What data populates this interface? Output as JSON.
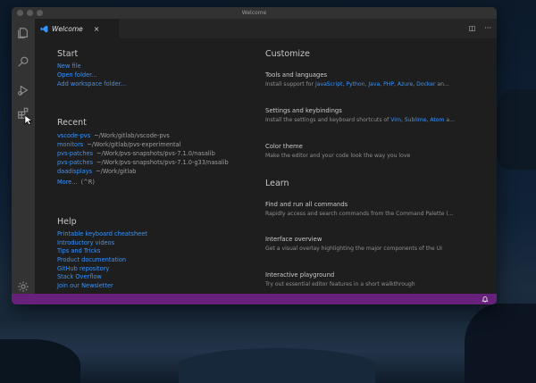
{
  "window": {
    "title": "Welcome"
  },
  "tab": {
    "label": "Welcome",
    "close": "×"
  },
  "editor_actions": {
    "split": "◫",
    "more": "···"
  },
  "start": {
    "heading": "Start",
    "items": [
      "New file",
      "Open folder...",
      "Add workspace folder..."
    ]
  },
  "recent": {
    "heading": "Recent",
    "items": [
      {
        "name": "vscode-pvs",
        "path": "~/Work/gitlab/vscode-pvs"
      },
      {
        "name": "monitors",
        "path": "~/Work/gitlab/pvs-experimental"
      },
      {
        "name": "pvs-patches",
        "path": "~/Work/pvs-snapshots/pvs-7.1.0/nasalib"
      },
      {
        "name": "pvs-patches",
        "path": "~/Work/pvs-snapshots/pvs-7.1.0-g33/nasalib"
      },
      {
        "name": "daadisplays",
        "path": "~/Work/gitlab"
      }
    ],
    "more": "More...",
    "more_shortcut": "(^R)"
  },
  "help": {
    "heading": "Help",
    "items": [
      "Printable keyboard cheatsheet",
      "Introductory videos",
      "Tips and Tricks",
      "Product documentation",
      "GitHub repository",
      "Stack Overflow",
      "Join our Newsletter"
    ]
  },
  "customize": {
    "heading": "Customize",
    "tools": {
      "title": "Tools and languages",
      "prefix": "Install support for ",
      "links": [
        "JavaScript",
        "Python",
        "Java",
        "PHP",
        "Azure",
        "Docker"
      ],
      "suffix": " an..."
    },
    "settings": {
      "title": "Settings and keybindings",
      "prefix": "Install the settings and keyboard shortcuts of ",
      "links": [
        "Vim",
        "Sublime",
        "Atom"
      ],
      "suffix": " a..."
    },
    "theme": {
      "title": "Color theme",
      "desc": "Make the editor and your code look the way you love"
    }
  },
  "learn": {
    "heading": "Learn",
    "items": [
      {
        "title": "Find and run all commands",
        "desc": "Rapidly access and search commands from the Command Palette (..."
      },
      {
        "title": "Interface overview",
        "desc": "Get a visual overlay highlighting the major components of the UI"
      },
      {
        "title": "Interactive playground",
        "desc": "Try out essential editor features in a short walkthrough"
      }
    ]
  },
  "colors": {
    "statusbar": "#68217a",
    "link": "#3794ff",
    "editor_bg": "#1e1e1e",
    "activitybar_bg": "#333333"
  },
  "icons": {
    "activity": [
      "files-icon",
      "search-icon",
      "run-debug-icon",
      "extensions-icon",
      "settings-gear-icon"
    ],
    "status": "notification-bell-icon"
  }
}
